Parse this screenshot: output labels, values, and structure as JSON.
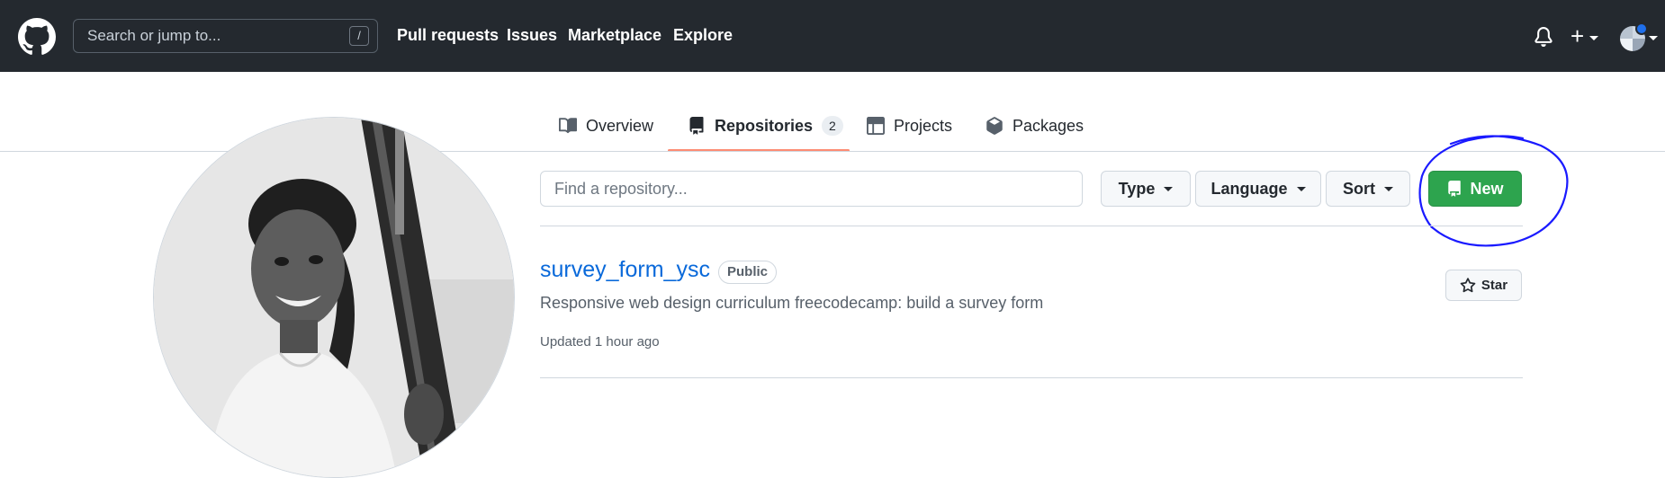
{
  "header": {
    "search_placeholder": "Search or jump to...",
    "search_shortcut": "/",
    "nav": [
      "Pull requests",
      "Issues",
      "Marketplace",
      "Explore"
    ],
    "plus_symbol": "+"
  },
  "tabs": [
    {
      "label": "Overview",
      "icon": "book-icon"
    },
    {
      "label": "Repositories",
      "icon": "repo-icon",
      "count": "2",
      "active": true
    },
    {
      "label": "Projects",
      "icon": "table-icon"
    },
    {
      "label": "Packages",
      "icon": "package-icon"
    }
  ],
  "filters": {
    "find_placeholder": "Find a repository...",
    "type_label": "Type",
    "language_label": "Language",
    "sort_label": "Sort",
    "new_label": "New"
  },
  "repos": [
    {
      "name": "survey_form_ysc",
      "visibility": "Public",
      "description": "Responsive web design curriculum freecodecamp: build a survey form",
      "updated": "Updated 1 hour ago",
      "star_label": "Star"
    }
  ],
  "colors": {
    "header_bg": "#24292f",
    "accent_green": "#2da44e",
    "link_blue": "#0969da",
    "tab_underline": "#fd8c73",
    "annotation_ink": "#1a1aff"
  }
}
